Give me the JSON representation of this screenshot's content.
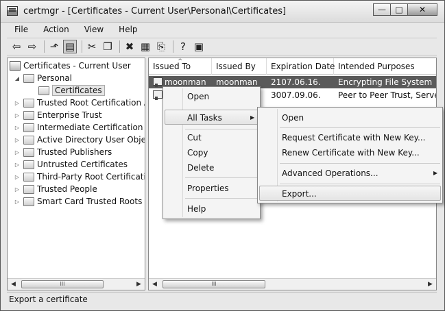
{
  "window": {
    "title": "certmgr - [Certificates - Current User\\Personal\\Certificates]",
    "buttons": {
      "minimize": "—",
      "maximize": "□",
      "close": "✕"
    }
  },
  "menubar": [
    "File",
    "Action",
    "View",
    "Help"
  ],
  "toolbar": {
    "icons": [
      "back-arrow-icon",
      "forward-arrow-icon",
      "up-folder-icon",
      "show-hide-tree-icon",
      "cut-icon",
      "copy-icon",
      "delete-icon",
      "properties-icon",
      "export-list-icon",
      "help-icon",
      "show-action-pane-icon"
    ]
  },
  "tree": {
    "root": "Certificates - Current User",
    "personal": "Personal",
    "certificates": "Certificates",
    "items": [
      "Trusted Root Certification Au",
      "Enterprise Trust",
      "Intermediate Certification Au",
      "Active Directory User Object",
      "Trusted Publishers",
      "Untrusted Certificates",
      "Third-Party Root Certification",
      "Trusted People",
      "Smart Card Trusted Roots"
    ],
    "scroll_thumb": "III"
  },
  "list": {
    "columns": [
      "Issued To",
      "Issued By",
      "Expiration Date",
      "Intended Purposes"
    ],
    "rows": [
      {
        "issued_to": "moonman",
        "issued_by": "moonman",
        "expiration": "2107.06.16.",
        "purposes": "Encrypting File System"
      },
      {
        "issued_to": "",
        "issued_by": "",
        "expiration": "3007.09.06.",
        "purposes": "Peer to Peer Trust, Server A"
      }
    ],
    "scroll_thumb": "III"
  },
  "context_menu": {
    "open": "Open",
    "all_tasks": "All Tasks",
    "cut": "Cut",
    "copy": "Copy",
    "delete": "Delete",
    "properties": "Properties",
    "help": "Help"
  },
  "submenu": {
    "open": "Open",
    "request_new_key": "Request Certificate with New Key...",
    "renew_new_key": "Renew Certificate with New Key...",
    "advanced": "Advanced Operations...",
    "export": "Export..."
  },
  "status": "Export a certificate"
}
